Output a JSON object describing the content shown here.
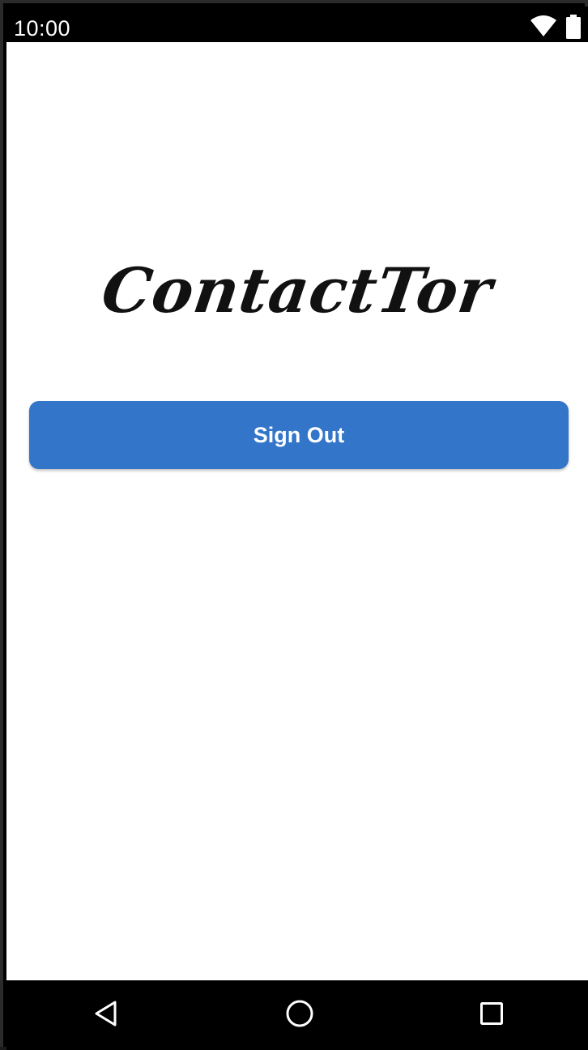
{
  "status_bar": {
    "time": "10:00",
    "icons": [
      "wifi-icon",
      "battery-icon"
    ]
  },
  "app": {
    "logo_text": "ContactTor",
    "sign_out_label": "Sign Out",
    "accent_color": "#3375c8"
  },
  "nav_bar": {
    "icons": [
      "back-icon",
      "home-icon",
      "recents-icon"
    ]
  }
}
